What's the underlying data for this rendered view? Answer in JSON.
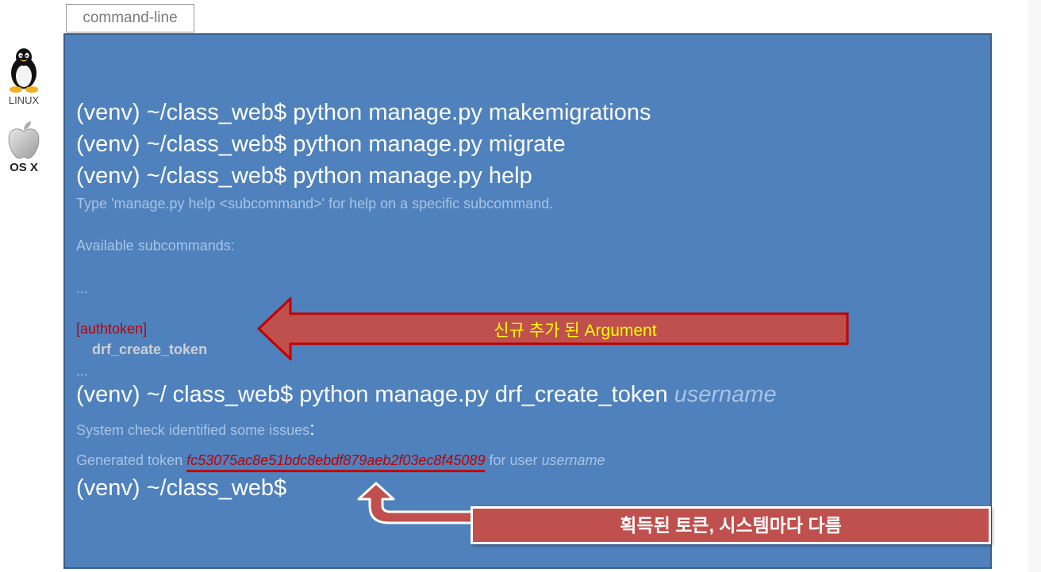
{
  "tab": {
    "label": "command-line"
  },
  "os": {
    "linux_label": "LINUX",
    "mac_label": "OS X"
  },
  "terminal": {
    "cmd1": "(venv) ~/class_web$ python manage.py makemigrations",
    "cmd2": "(venv) ~/class_web$ python manage.py migrate",
    "cmd3": "(venv) ~/class_web$ python manage.py help",
    "help_hint": "Type 'manage.py help <subcommand>' for help on a specific subcommand.",
    "available": "Available subcommands:",
    "ellipsis1": "...",
    "authtoken": "[authtoken]",
    "drf_cmd": "drf_create_token",
    "ellipsis2": "...",
    "cmd4_prefix": "(venv) ~/ class_web$ python manage.py drf_create_token ",
    "cmd4_arg": "username",
    "syscheck": "System check identified some issues",
    "syscheck_colon": ":",
    "generated_prefix": "Generated token ",
    "token": "fc53075ac8e51bdc8ebdf879aeb2f03ec8f45089",
    "for_user": " for user ",
    "user": "username",
    "prompt": "(venv) ~/class_web$"
  },
  "annotations": {
    "new_argument_prefix": "신규 추가 된 ",
    "new_argument_word": "Argument",
    "token_note": "획득된 토큰, 시스템마다 다름"
  },
  "colors": {
    "terminal_bg": "#4f81bd",
    "terminal_border": "#385d8a",
    "arrow_fill": "#c0504d",
    "highlight_red": "#c00000",
    "note_text": "#ffff00"
  }
}
